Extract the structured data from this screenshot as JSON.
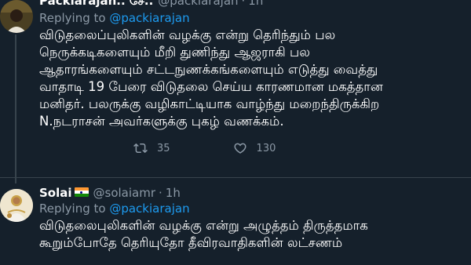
{
  "tweets": [
    {
      "name": "Packiarajan.. சே..",
      "handle": "@packiarajan",
      "dot": "·",
      "time": "1h",
      "replying_prefix": "Replying to ",
      "replying_to": "@packiarajan",
      "lines": [
        "விடுதலைப்புலிகளின் வழக்கு என்று தெரிந்தும் பல",
        "நெருக்கடிகளையும் மீறி துணிந்து ஆஜராகி பல",
        "ஆதாரங்களையும் சட்டநுணக்கங்களையும் எடுத்து வைத்து",
        "வாதாடி 19 பேரை விடுதலை செய்ய காரணமான மகத்தான",
        "மனிதர். பலருக்கு வழிகாட்டியாக வாழ்ந்து மறைந்திருக்கிற",
        "N.நடராசன் அவர்களுக்கு புகழ் வணக்கம்."
      ],
      "actions": {
        "retweet_icon": "retweet-icon",
        "retweet_count": "35",
        "like_icon": "heart-icon",
        "like_count": "130"
      }
    },
    {
      "name": "Solai",
      "flag_icon": "india-flag-icon",
      "handle": "@solaiamr",
      "dot": "·",
      "time": "1h",
      "replying_prefix": "Replying to ",
      "replying_to": "@packiarajan",
      "lines": [
        "விடுதலைபுலிகளின் வழக்கு என்று அழுத்தம் திருத்தமாக",
        "கூறும்போதே தெரியுதோ தீவிரவாதிகளின் லட்சணம்"
      ]
    }
  ],
  "colors": {
    "background": "#15202b",
    "text": "#ffffff",
    "secondary": "#8b98a5",
    "link": "#1d9bf0",
    "divider": "#38444d"
  }
}
